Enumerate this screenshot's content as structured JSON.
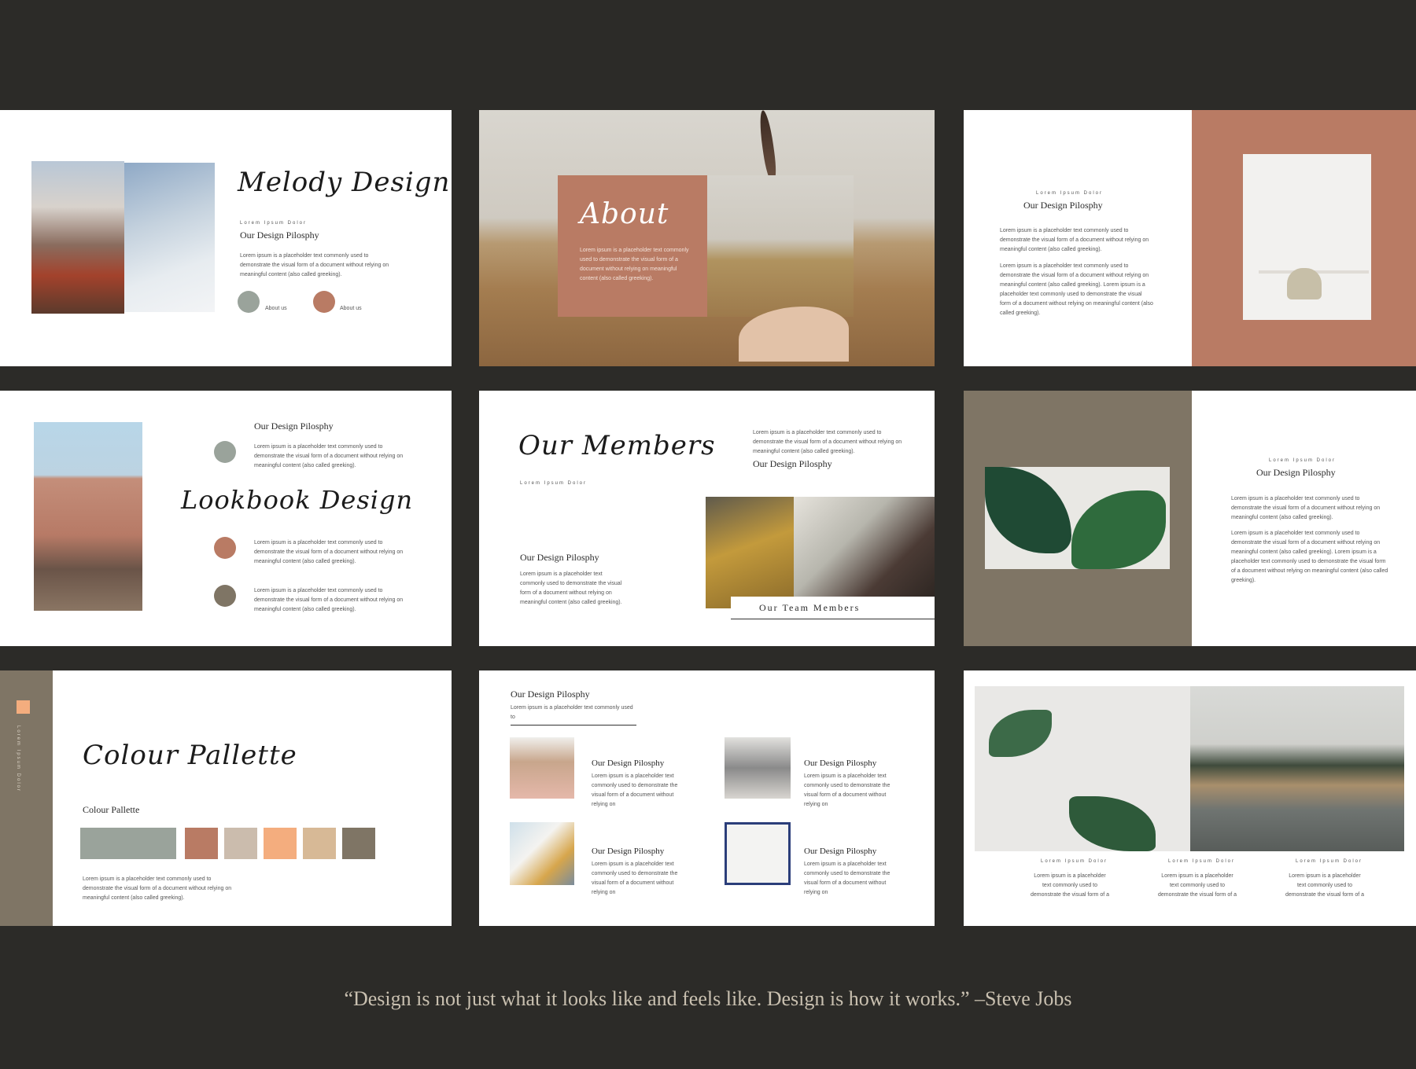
{
  "colors": {
    "background": "#2c2b28",
    "terracotta": "#b97b64",
    "taupe": "#7f7565",
    "sage": "#9aa39b"
  },
  "slide1": {
    "title": "Melody Design",
    "kicker": "Lorem Ipsum Dolor",
    "heading": "Our Design Pilosphy",
    "body": "Lorem ipsum is a placeholder text commonly used to demonstrate the visual form of a document without relying on meaningful content (also called greeking).",
    "btn1": "About us",
    "btn2": "About us"
  },
  "slide2": {
    "title": "About",
    "body": "Lorem ipsum is a placeholder text commonly used to demonstrate the visual form of a document without relying on meaningful content (also called greeking)."
  },
  "slide3": {
    "kicker": "Lorem Ipsum Dolor",
    "heading": "Our Design Pilosphy",
    "body1": "Lorem ipsum is a placeholder text commonly used to demonstrate the visual form of a document without relying on meaningful content (also called greeking).",
    "body2": "Lorem ipsum is a placeholder text commonly used to demonstrate the visual form of a document without relying on meaningful content (also called greeking). Lorem ipsum is a placeholder text commonly used to demonstrate the visual form of a document without relying on meaningful content (also called greeking)."
  },
  "slide4": {
    "heading": "Our Design Pilosphy",
    "title": "Lookbook Design",
    "body1": "Lorem ipsum is a placeholder text commonly used to demonstrate the visual form of a document without relying on meaningful content (also called greeking).",
    "body2": "Lorem ipsum is a placeholder text commonly used to demonstrate the visual form of a document without relying on meaningful content (also called greeking).",
    "body3": "Lorem ipsum is a placeholder text commonly used to demonstrate the visual form of a document without relying on meaningful content (also called greeking)."
  },
  "slide5": {
    "title": "Our Members",
    "kicker": "Lorem Ipsum Dolor",
    "body_top": "Lorem ipsum is a placeholder text commonly used to demonstrate the visual form of a document without relying on meaningful content (also called greeking).",
    "heading_top": "Our Design Pilosphy",
    "heading_left": "Our Design Pilosphy",
    "body_left": "Lorem ipsum is a placeholder text commonly used to demonstrate the visual form of a document without relying on meaningful content (also called greeking).",
    "caption": "Our Team Members"
  },
  "slide6": {
    "kicker": "Lorem Ipsum Dolor",
    "heading": "Our Design Pilosphy",
    "body1": "Lorem ipsum is a placeholder text commonly used to demonstrate the visual form of a document without relying on meaningful content (also called greeking).",
    "body2": "Lorem ipsum is a placeholder text commonly used to demonstrate the visual form of a document without relying on meaningful content (also called greeking). Lorem ipsum is a placeholder text commonly used to demonstrate the visual form of a document without relying on meaningful content (also called greeking)."
  },
  "slide7": {
    "side_label": "Lorem Ipsum Dolor",
    "title": "Colour Pallette",
    "subtitle": "Colour Pallette",
    "swatches": [
      "#9aa39b",
      "#b97b64",
      "#cbbcad",
      "#f4ad7e",
      "#d7b996",
      "#7f7565"
    ],
    "body": "Lorem ipsum is a placeholder text commonly used to demonstrate the visual form of a document without relying on meaningful content (also called greeking)."
  },
  "slide8": {
    "heading": "Our Design Pilosphy",
    "sub": "Lorem ipsum is a placeholder text commonly used to",
    "item_heading": "Our Design Pilosphy",
    "item_body": "Lorem ipsum is a placeholder text commonly used to demonstrate the visual form of a document without relying on"
  },
  "slide9": {
    "kicker": "Lorem Ipsum Dolor",
    "body": "Lorem ipsum is a placeholder text commonly used to demonstrate the visual form of a"
  },
  "quote": "“Design is not just what it looks like and feels like. Design is how it works.” –Steve Jobs"
}
